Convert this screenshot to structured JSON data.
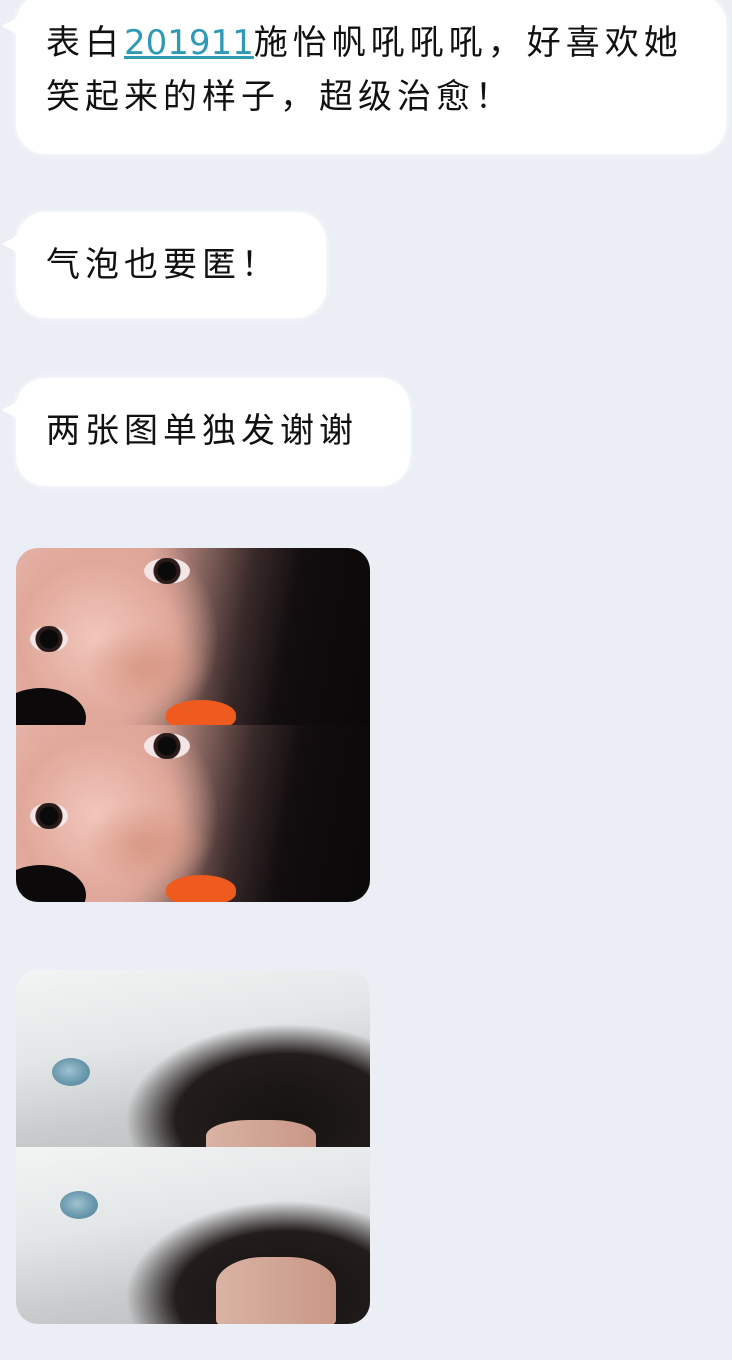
{
  "messages": [
    {
      "link_text": "201911",
      "text_before": "表白",
      "text_after": "施怡帆吼吼吼，好喜欢她笑起来的样子，超级治愈！"
    },
    {
      "text": "气泡也要匿！"
    },
    {
      "text": "两张图单独发谢谢"
    }
  ],
  "images": [
    {
      "name": "selfie-photo",
      "description_icon": "photo-icon"
    },
    {
      "name": "bathroom-photo",
      "description_icon": "photo-icon"
    }
  ],
  "colors": {
    "background": "#ebeff5",
    "bubble": "#ffffff",
    "link": "#2e9ab5",
    "text": "#111111"
  }
}
